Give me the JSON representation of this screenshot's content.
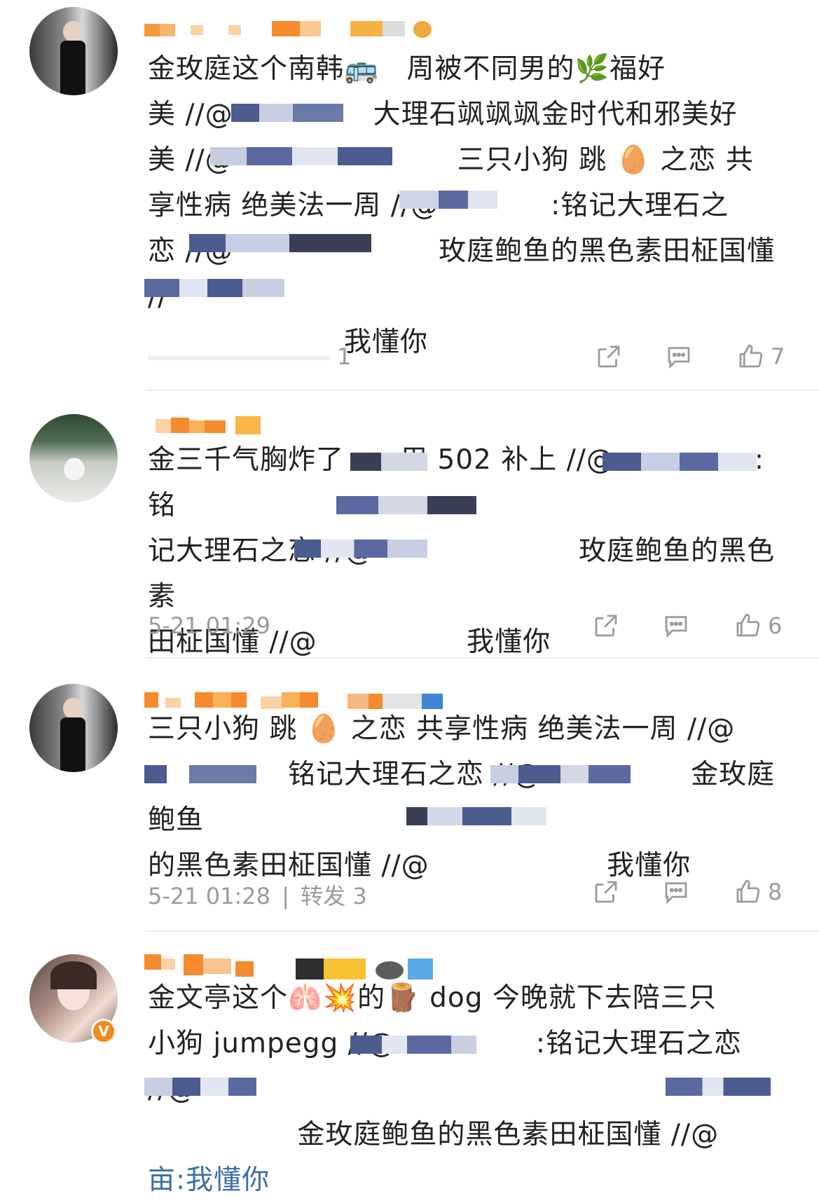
{
  "comments": [
    {
      "text_lines": [
        "金玫庭这个南韩🚌　周被不同男的🌿福好",
        "美 //@　　　　　大理石飒飒飒金时代和邪美好",
        "美 //@　　　　　　　　三只小狗 跳 🥚 之恋 共",
        "享性病 绝美法一周 //@　　　　:铭记大理石之",
        "恋 //@　　　　　　　 玫庭鲍鱼的黑色素田柾国懂 //",
        "　　　　　　　我懂你"
      ],
      "time": "",
      "reply_count": "1",
      "share_icon": "share-icon",
      "comment_icon": "comment-icon",
      "like_icon": "thumbs-up-icon",
      "likes": "7"
    },
    {
      "text_lines": [
        "金三千气胸炸了　　用 502 补上 //@　　　　　:铭",
        "记大理石之恋 //@　　　　　　　 玫庭鲍鱼的黑色素",
        "田柾国懂 //@　　　　　 我懂你"
      ],
      "time": "5-21 01:29",
      "likes": "6"
    },
    {
      "text_lines": [
        "三只小狗 跳 🥚 之恋 共享性病 绝美法一周 //@",
        "　　　　　铭记大理石之恋 //@　　　　　 金玫庭鲍鱼",
        "的黑色素田柾国懂 //@　　　　　　 我懂你"
      ],
      "time": "5-21 01:28",
      "reposts": "转发 3",
      "likes": "8"
    },
    {
      "text_lines": [
        "金文亭这个🫁💥的🪵 dog 今晚就下去陪三只",
        "小狗 jumpegg //@　　　　　:铭记大理石之恋 //@",
        "　　　　　 金玫庭鲍鱼的黑色素田柾国懂 //@　　　",
        "亩:我懂你"
      ],
      "verified_badge": "V"
    }
  ],
  "colors": {
    "text": "#222222",
    "meta": "#9b9b9b",
    "accent": "#f08a1c",
    "link": "#3f6ea8"
  }
}
